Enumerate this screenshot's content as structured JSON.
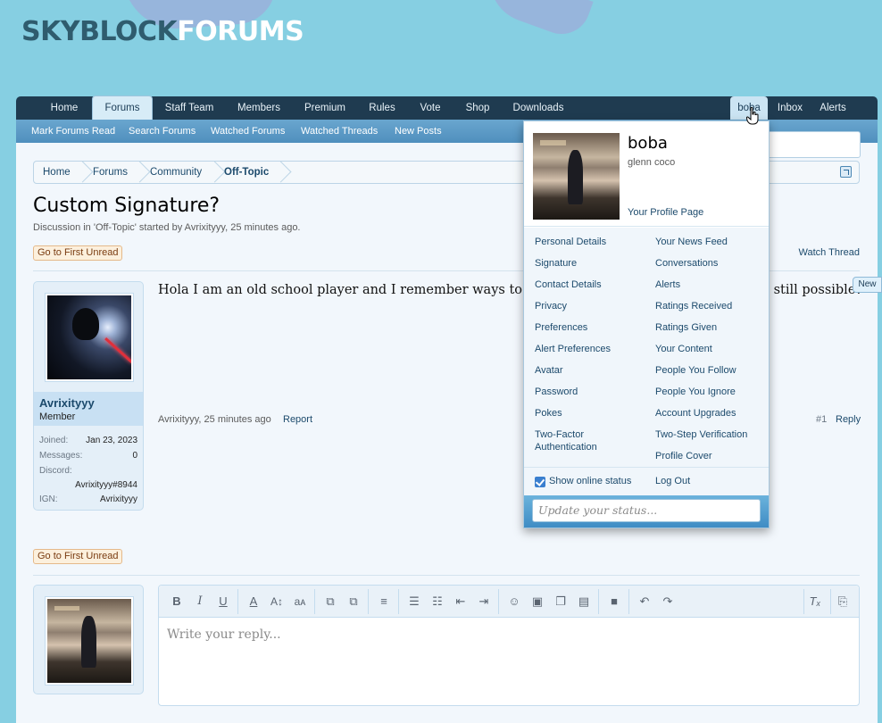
{
  "logo": {
    "part1": "SKYBLOCK",
    "part2": "FORUMS"
  },
  "nav": {
    "tabs": [
      "Home",
      "Forums",
      "Staff Team",
      "Members",
      "Premium",
      "Rules",
      "Vote",
      "Shop",
      "Downloads"
    ],
    "active_tab": "Forums",
    "user_tabs": [
      "boba",
      "Inbox",
      "Alerts"
    ]
  },
  "subnav": [
    "Mark Forums Read",
    "Search Forums",
    "Watched Forums",
    "Watched Threads",
    "New Posts"
  ],
  "breadcrumb": [
    "Home",
    "Forums",
    "Community",
    "Off-Topic"
  ],
  "thread": {
    "title": "Custom Signature?",
    "meta": "Discussion in 'Off-Topic' started by Avrixityyy, 25 minutes ago.",
    "go_first_unread": "Go to First Unread",
    "watch": "Watch Thread"
  },
  "post": {
    "text": "Hola I am an old school player and I remember ways to get a custom forum signature. Is this still possible?",
    "author": "Avrixityyy",
    "author_title": "Member",
    "info": [
      {
        "label": "Joined:",
        "value": "Jan 23, 2023"
      },
      {
        "label": "Messages:",
        "value": "0"
      },
      {
        "label": "Discord:",
        "value": "Avrixityyy#8944"
      },
      {
        "label": "IGN:",
        "value": "Avrixityyy"
      }
    ],
    "footer_meta": "Avrixityyy, 25 minutes ago",
    "report": "Report",
    "number": "#1",
    "reply": "Reply"
  },
  "new_badge": "New",
  "editor": {
    "placeholder": "Write your reply..."
  },
  "dropdown": {
    "name": "boba",
    "subtitle": "glenn coco",
    "profile_link": "Your Profile Page",
    "left_links": [
      "Personal Details",
      "Signature",
      "Contact Details",
      "Privacy",
      "Preferences",
      "Alert Preferences",
      "Avatar",
      "Password",
      "Pokes",
      "Two-Factor Authentication"
    ],
    "right_links": [
      "Your News Feed",
      "Conversations",
      "Alerts",
      "Ratings Received",
      "Ratings Given",
      "Your Content",
      "People You Follow",
      "People You Ignore",
      "Account Upgrades",
      "Two-Step Verification",
      "Profile Cover"
    ],
    "show_online": "Show online status",
    "logout": "Log Out",
    "status_placeholder": "Update your status..."
  }
}
